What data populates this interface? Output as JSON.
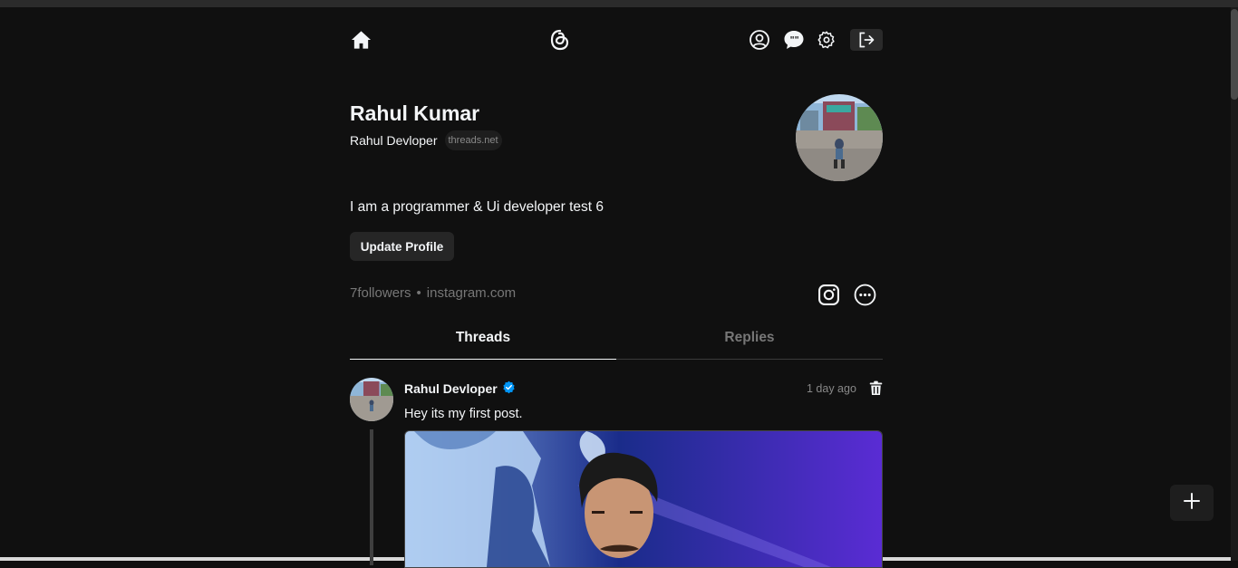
{
  "header": {
    "icons": [
      "home-icon",
      "threads-logo-icon",
      "profile-icon",
      "chat-icon",
      "settings-icon",
      "logout-icon"
    ]
  },
  "profile": {
    "name": "Rahul Kumar",
    "username": "Rahul Devloper",
    "domain_badge": "threads.net",
    "bio": "I am a programmer & Ui developer test 6",
    "update_button": "Update Profile",
    "followers": "7followers",
    "separator": "•",
    "link": "instagram.com"
  },
  "tabs": [
    {
      "label": "Threads",
      "active": true
    },
    {
      "label": "Replies",
      "active": false
    }
  ],
  "post": {
    "author": "Rahul Devloper",
    "verified": true,
    "time": "1 day ago",
    "text": "Hey its my first post."
  },
  "colors": {
    "background": "#101010",
    "text": "#f3f5f7",
    "muted": "#777777",
    "verified": "#0095f6"
  }
}
